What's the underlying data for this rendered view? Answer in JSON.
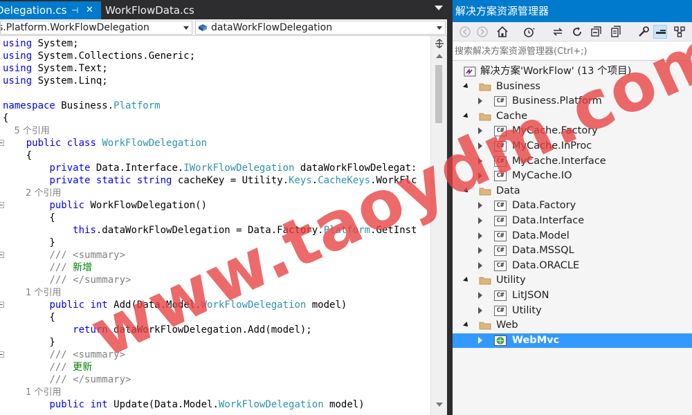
{
  "editor": {
    "tabs": [
      {
        "label": "Delegation.cs",
        "pin_glyph": "⊣",
        "close_glyph": "✕",
        "active": true
      },
      {
        "label": "WorkFlowData.cs",
        "active": false
      }
    ],
    "nav": {
      "type_combo": "s.Platform.WorkFlowDelegation",
      "member_combo": "dataWorkFlowDelegation"
    },
    "code_lines": [
      "using System;",
      "using System.Collections.Generic;",
      "using System.Text;",
      "using System.Linq;",
      "",
      "namespace Business.Platform",
      "{",
      "    5 个引用",
      "    public class WorkFlowDelegation",
      "    {",
      "        private Data.Interface.IWorkFlowDelegation dataWorkFlowDelegat:",
      "        private static string cacheKey = Utility.Keys.CacheKeys.WorkFlc",
      "        2 个引用",
      "        public WorkFlowDelegation()",
      "        {",
      "            this.dataWorkFlowDelegation = Data.Factory.Platform.GetInst",
      "        }",
      "        /// <summary>",
      "        /// 新增",
      "        /// </summary>",
      "        1 个引用",
      "        public int Add(Data.Model.WorkFlowDelegation model)",
      "        {",
      "            return dataWorkFlowDelegation.Add(model);",
      "        }",
      "        /// <summary>",
      "        /// 更新",
      "        /// </summary>",
      "        1 个引用",
      "        public int Update(Data.Model.WorkFlowDelegation model)"
    ]
  },
  "explorer": {
    "title": "解决方案资源管理器",
    "search_placeholder": "搜索解决方案资源管理器(Ctrl+;)",
    "toolbar_icons": [
      "back-icon",
      "forward-icon",
      "home-icon",
      "history-icon",
      "sync-icon",
      "refresh-icon",
      "collapse-all-icon",
      "show-files-icon",
      "properties-icon",
      "preview-icon",
      "class-view-icon"
    ],
    "tree": [
      {
        "label": "解决方案'WorkFlow' (13 个项目)",
        "kind": "solution",
        "level": 0
      },
      {
        "label": "Business",
        "kind": "folder",
        "level": 1,
        "expanded": true
      },
      {
        "label": "Business.Platform",
        "kind": "project",
        "level": 2
      },
      {
        "label": "Cache",
        "kind": "folder",
        "level": 1,
        "expanded": true
      },
      {
        "label": "MyCache.Factory",
        "kind": "project",
        "level": 2
      },
      {
        "label": "MyCache.InProc",
        "kind": "project",
        "level": 2
      },
      {
        "label": "MyCache.Interface",
        "kind": "project",
        "level": 2
      },
      {
        "label": "MyCache.IO",
        "kind": "project",
        "level": 2
      },
      {
        "label": "Data",
        "kind": "folder",
        "level": 1,
        "expanded": true
      },
      {
        "label": "Data.Factory",
        "kind": "project",
        "level": 2
      },
      {
        "label": "Data.Interface",
        "kind": "project",
        "level": 2
      },
      {
        "label": "Data.Model",
        "kind": "project",
        "level": 2
      },
      {
        "label": "Data.MSSQL",
        "kind": "project",
        "level": 2
      },
      {
        "label": "Data.ORACLE",
        "kind": "project",
        "level": 2
      },
      {
        "label": "Utility",
        "kind": "folder",
        "level": 1,
        "expanded": true
      },
      {
        "label": "LitJSON",
        "kind": "project",
        "level": 2
      },
      {
        "label": "Utility",
        "kind": "project",
        "level": 2
      },
      {
        "label": "Web",
        "kind": "folder",
        "level": 1,
        "expanded": true
      },
      {
        "label": "WebMvc",
        "kind": "web",
        "level": 2,
        "selected": true
      }
    ],
    "project_icon_text": "C#"
  },
  "watermark": "www.taoydm.com",
  "colors": {
    "accent": "#007acc",
    "selection": "#3399ff",
    "keyword": "#0000ff",
    "type": "#2b91af",
    "comment": "#808080",
    "watermark": "#e84040"
  }
}
